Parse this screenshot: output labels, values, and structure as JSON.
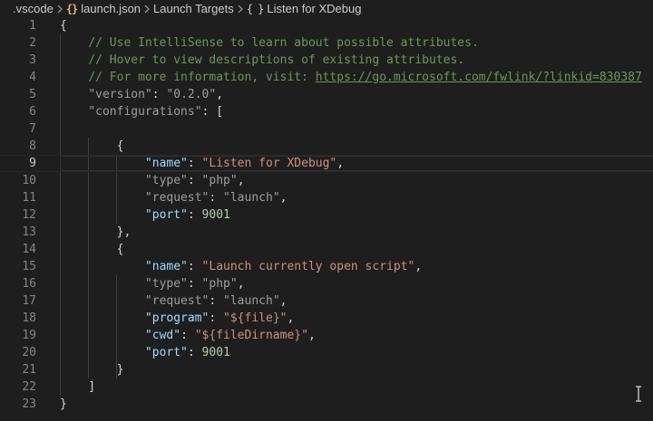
{
  "breadcrumbs": {
    "items": [
      {
        "label": ".vscode",
        "icon": ""
      },
      {
        "label": "launch.json",
        "icon": "{}"
      },
      {
        "label": "Launch Targets",
        "icon": ""
      },
      {
        "label": "Listen for XDebug",
        "icon": "{ }"
      }
    ]
  },
  "editor": {
    "current_line": 9,
    "lines": [
      {
        "n": "1",
        "tokens": [
          {
            "t": "{",
            "c": "punc"
          }
        ]
      },
      {
        "n": "2",
        "tokens": [
          {
            "t": "    ",
            "c": "punc"
          },
          {
            "t": "// Use IntelliSense to learn about possible attributes.",
            "c": "comment"
          }
        ]
      },
      {
        "n": "3",
        "tokens": [
          {
            "t": "    ",
            "c": "punc"
          },
          {
            "t": "// Hover to view descriptions of existing attributes.",
            "c": "comment"
          }
        ]
      },
      {
        "n": "4",
        "tokens": [
          {
            "t": "    ",
            "c": "punc"
          },
          {
            "t": "// For more information, visit: ",
            "c": "comment"
          },
          {
            "t": "https://go.microsoft.com/fwlink/?linkid=830387",
            "c": "link"
          }
        ]
      },
      {
        "n": "5",
        "tokens": [
          {
            "t": "    ",
            "c": "punc"
          },
          {
            "t": "\"version\"",
            "c": "key-muted"
          },
          {
            "t": ": ",
            "c": "punc"
          },
          {
            "t": "\"0.2.0\"",
            "c": "str-muted"
          },
          {
            "t": ",",
            "c": "punc"
          }
        ]
      },
      {
        "n": "6",
        "tokens": [
          {
            "t": "    ",
            "c": "punc"
          },
          {
            "t": "\"configurations\"",
            "c": "key-muted"
          },
          {
            "t": ": [",
            "c": "punc"
          }
        ]
      },
      {
        "n": "7",
        "tokens": []
      },
      {
        "n": "8",
        "tokens": [
          {
            "t": "        {",
            "c": "punc"
          }
        ]
      },
      {
        "n": "9",
        "tokens": [
          {
            "t": "            ",
            "c": "punc"
          },
          {
            "t": "\"name\"",
            "c": "key"
          },
          {
            "t": ": ",
            "c": "punc"
          },
          {
            "t": "\"Listen for XDebug\"",
            "c": "str"
          },
          {
            "t": ",",
            "c": "punc"
          }
        ]
      },
      {
        "n": "10",
        "tokens": [
          {
            "t": "            ",
            "c": "punc"
          },
          {
            "t": "\"type\"",
            "c": "key-muted"
          },
          {
            "t": ": ",
            "c": "punc"
          },
          {
            "t": "\"php\"",
            "c": "str-muted"
          },
          {
            "t": ",",
            "c": "punc"
          }
        ]
      },
      {
        "n": "11",
        "tokens": [
          {
            "t": "            ",
            "c": "punc"
          },
          {
            "t": "\"request\"",
            "c": "key-muted"
          },
          {
            "t": ": ",
            "c": "punc"
          },
          {
            "t": "\"launch\"",
            "c": "str-muted"
          },
          {
            "t": ",",
            "c": "punc"
          }
        ]
      },
      {
        "n": "12",
        "tokens": [
          {
            "t": "            ",
            "c": "punc"
          },
          {
            "t": "\"port\"",
            "c": "key"
          },
          {
            "t": ": ",
            "c": "punc"
          },
          {
            "t": "9001",
            "c": "num"
          }
        ]
      },
      {
        "n": "13",
        "tokens": [
          {
            "t": "        },",
            "c": "punc"
          }
        ]
      },
      {
        "n": "14",
        "tokens": [
          {
            "t": "        {",
            "c": "punc"
          }
        ]
      },
      {
        "n": "15",
        "tokens": [
          {
            "t": "            ",
            "c": "punc"
          },
          {
            "t": "\"name\"",
            "c": "key"
          },
          {
            "t": ": ",
            "c": "punc"
          },
          {
            "t": "\"Launch currently open script\"",
            "c": "str"
          },
          {
            "t": ",",
            "c": "punc"
          }
        ]
      },
      {
        "n": "16",
        "tokens": [
          {
            "t": "            ",
            "c": "punc"
          },
          {
            "t": "\"type\"",
            "c": "key-muted"
          },
          {
            "t": ": ",
            "c": "punc"
          },
          {
            "t": "\"php\"",
            "c": "str-muted"
          },
          {
            "t": ",",
            "c": "punc"
          }
        ]
      },
      {
        "n": "17",
        "tokens": [
          {
            "t": "            ",
            "c": "punc"
          },
          {
            "t": "\"request\"",
            "c": "key-muted"
          },
          {
            "t": ": ",
            "c": "punc"
          },
          {
            "t": "\"launch\"",
            "c": "str-muted"
          },
          {
            "t": ",",
            "c": "punc"
          }
        ]
      },
      {
        "n": "18",
        "tokens": [
          {
            "t": "            ",
            "c": "punc"
          },
          {
            "t": "\"program\"",
            "c": "key"
          },
          {
            "t": ": ",
            "c": "punc"
          },
          {
            "t": "\"${file}\"",
            "c": "str"
          },
          {
            "t": ",",
            "c": "punc"
          }
        ]
      },
      {
        "n": "19",
        "tokens": [
          {
            "t": "            ",
            "c": "punc"
          },
          {
            "t": "\"cwd\"",
            "c": "key"
          },
          {
            "t": ": ",
            "c": "punc"
          },
          {
            "t": "\"${fileDirname}\"",
            "c": "str"
          },
          {
            "t": ",",
            "c": "punc"
          }
        ]
      },
      {
        "n": "20",
        "tokens": [
          {
            "t": "            ",
            "c": "punc"
          },
          {
            "t": "\"port\"",
            "c": "key"
          },
          {
            "t": ": ",
            "c": "punc"
          },
          {
            "t": "9001",
            "c": "num"
          }
        ]
      },
      {
        "n": "21",
        "tokens": [
          {
            "t": "        }",
            "c": "punc"
          }
        ]
      },
      {
        "n": "22",
        "tokens": [
          {
            "t": "    ]",
            "c": "punc"
          }
        ]
      },
      {
        "n": "23",
        "tokens": [
          {
            "t": "}",
            "c": "punc"
          }
        ]
      }
    ]
  },
  "colors": {
    "background": "#1e1e1e",
    "comment": "#6a9955",
    "key": "#9cdcfe",
    "string": "#ce9178",
    "number": "#b5cea8",
    "line_number": "#858585"
  },
  "icons": {
    "breadcrumb_separator": "chevron-right-icon",
    "json_file": "json-file-icon",
    "object_symbol": "object-symbol-icon",
    "cursor": "text-cursor-icon"
  }
}
